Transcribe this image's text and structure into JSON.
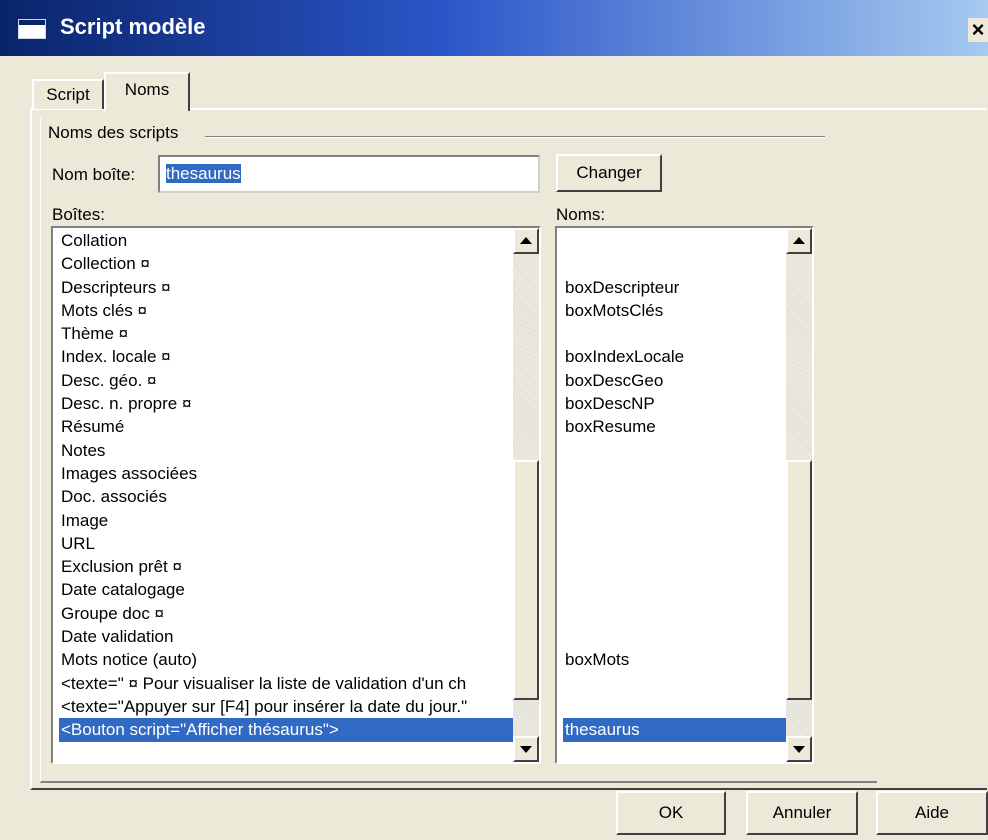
{
  "window": {
    "title": "Script modèle",
    "close_glyph": "×",
    "close_icon": "close-icon"
  },
  "tabs": [
    {
      "label": "Script",
      "active": false
    },
    {
      "label": "Noms",
      "active": true
    }
  ],
  "group": {
    "label": "Noms des scripts"
  },
  "nom_boite": {
    "label": "Nom boîte:",
    "value": "thesaurus"
  },
  "buttons": {
    "changer": "Changer",
    "ok": "OK",
    "annuler": "Annuler",
    "aide": "Aide"
  },
  "boites": {
    "label": "Boîtes:",
    "items": [
      "Collation",
      "Collection ¤",
      "Descripteurs ¤",
      "Mots clés ¤",
      "Thème ¤",
      "Index. locale ¤",
      "Desc. géo. ¤",
      "Desc. n. propre ¤",
      "Résumé",
      "Notes",
      "Images associées",
      "Doc. associés",
      "Image",
      "URL",
      "Exclusion prêt ¤",
      "Date catalogage",
      "Groupe  doc ¤",
      "Date validation",
      "Mots notice (auto)",
      "<texte=\" ¤ Pour visualiser la liste de validation d'un ch",
      "<texte=\"Appuyer sur [F4] pour insérer la date du jour.\"",
      "<Bouton script=\"Afficher thésaurus\">"
    ],
    "selected_index": 21,
    "scroll_position": 0.85
  },
  "noms": {
    "label": "Noms:",
    "items": [
      "",
      "",
      "boxDescripteur",
      "boxMotsClés",
      "",
      "boxIndexLocale",
      "boxDescGeo",
      "boxDescNP",
      "boxResume",
      "",
      "",
      "",
      "",
      "",
      "",
      "",
      "",
      "",
      "boxMots",
      "",
      "",
      "thesaurus"
    ],
    "selected_index": 21,
    "scroll_position": 0.85
  },
  "colors": {
    "selection": "#316ac5",
    "dialog_bg": "#ece9d8",
    "titlebar_start": "#0a246a",
    "titlebar_end": "#a6caf0"
  }
}
